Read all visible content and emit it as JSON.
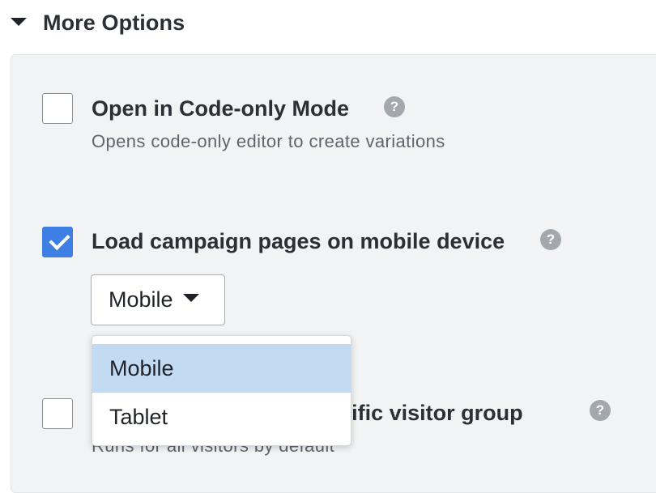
{
  "section": {
    "title": "More Options",
    "expanded": true
  },
  "options": [
    {
      "label": "Open in Code-only Mode",
      "description": "Opens code-only editor to create variations",
      "checked": false,
      "help": "?"
    },
    {
      "label": "Load campaign pages on mobile device",
      "description": "",
      "checked": true,
      "help": "?"
    },
    {
      "label": "Run campaign for a specific visitor group",
      "description": "Runs for all visitors by default",
      "checked": false,
      "help": "?"
    }
  ],
  "device_select": {
    "value": "Mobile",
    "options": [
      "Mobile",
      "Tablet"
    ],
    "highlighted": "Mobile"
  },
  "colors": {
    "accent": "#3d7fe3",
    "panel_bg": "#f2f3f4",
    "highlight": "#c3daf3",
    "help_icon": "#a3a8ae"
  }
}
